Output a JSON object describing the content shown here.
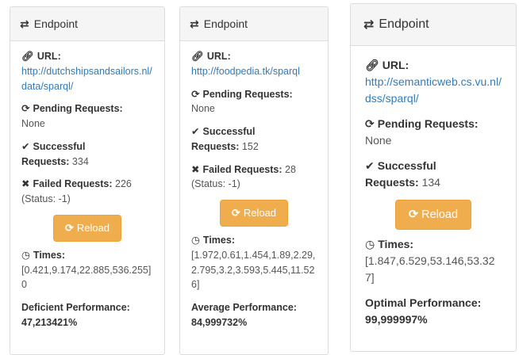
{
  "panels": [
    {
      "title": "Endpoint",
      "url_label": "URL:",
      "url": "http://dutchshipsandsailors.nl/data/sparql/",
      "pending_label": "Pending Requests:",
      "pending_value": "None",
      "successful_label_1": "Successful",
      "successful_label_2": "Requests:",
      "successful_value": "334",
      "failed_label": "Failed Requests:",
      "failed_value": "226",
      "failed_status": "(Status: -1)",
      "reload_label": "Reload",
      "times_label": "Times:",
      "times_value": "[0.421,9.174,22.885,536.255] 0",
      "perf_label": "Deficient Performance:",
      "perf_value": "47,213421%"
    },
    {
      "title": "Endpoint",
      "url_label": "URL:",
      "url": "http://foodpedia.tk/sparql",
      "pending_label": "Pending Requests:",
      "pending_value": "None",
      "successful_label_1": "Successful",
      "successful_label_2": "Requests:",
      "successful_value": "152",
      "failed_label": "Failed Requests:",
      "failed_value": "28",
      "failed_status": "(Status: -1)",
      "reload_label": "Reload",
      "times_label": "Times:",
      "times_value": "[1.972,0.61,1.454,1.89,2.29,2.795,3.2,3.593,5.445,11.526]",
      "perf_label": "Average Performance:",
      "perf_value": "84,999732%"
    },
    {
      "title": "Endpoint",
      "url_label": "URL:",
      "url": "http://semanticweb.cs.vu.nl/dss/sparql/",
      "pending_label": "Pending Requests:",
      "pending_value": "None",
      "successful_label_1": "Successful",
      "successful_label_2": "Requests:",
      "successful_value": "134",
      "reload_label": "Reload",
      "times_label": "Times:",
      "times_value": "[1.847,6.529,53.146,53.327]",
      "perf_label": "Optimal Performance:",
      "perf_value": "99,999997%"
    }
  ],
  "icons": {
    "endpoint": "exchange-icon",
    "url": "link-icon",
    "pending": "refresh-icon",
    "successful": "check-icon",
    "failed": "times-icon",
    "reload": "refresh-icon",
    "times": "clock-icon"
  },
  "colors": {
    "reload_button": "#f0ad4e",
    "link": "#337ab7",
    "header_bg": "#f5f5f5"
  }
}
